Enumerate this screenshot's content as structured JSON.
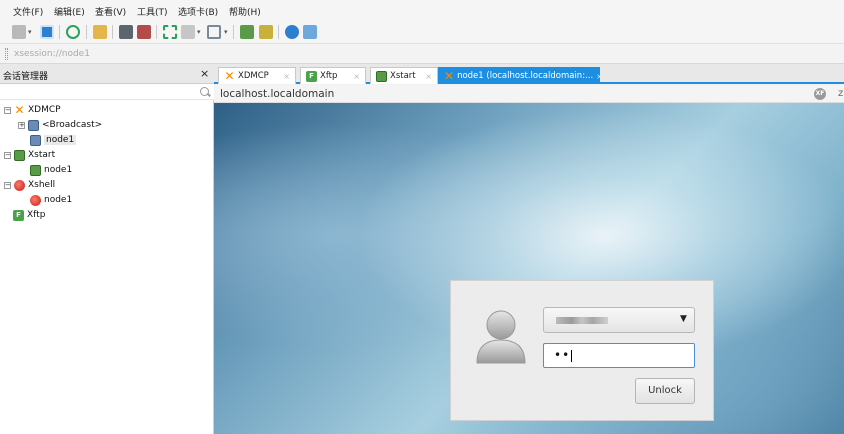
{
  "menubar": {
    "items": [
      "文件(F)",
      "编辑(E)",
      "查看(V)",
      "工具(T)",
      "选项卡(B)",
      "帮助(H)"
    ]
  },
  "toolbar": {
    "icons": [
      "new-session-icon",
      "session-properties-icon",
      "reconnect-icon",
      "find-icon",
      "screenshot-icon",
      "record-icon",
      "fullscreen-icon",
      "layout-icon",
      "tab-icon",
      "xstart-icon",
      "xftp-icon",
      "help-icon",
      "chat-icon"
    ]
  },
  "address": {
    "value": "xsession://node1"
  },
  "session_manager": {
    "title": "会话管理器",
    "close": "×",
    "tree": [
      {
        "label": "XDMCP",
        "icon": "xdmcp-icon",
        "expander": "−"
      },
      {
        "label": "<Broadcast>",
        "icon": "monitor-icon",
        "expander": "+"
      },
      {
        "label": "node1",
        "icon": "monitor-icon"
      },
      {
        "label": "Xstart",
        "icon": "xstart-icon",
        "expander": "−"
      },
      {
        "label": "node1",
        "icon": "xstart-icon"
      },
      {
        "label": "Xshell",
        "icon": "xshell-icon",
        "expander": "−"
      },
      {
        "label": "node1",
        "icon": "xshell-icon"
      },
      {
        "label": "Xftp",
        "icon": "xftp-icon"
      }
    ]
  },
  "tabs": [
    {
      "label": "XDMCP",
      "icon": "xdmcp-icon",
      "close": "×"
    },
    {
      "label": "Xftp",
      "icon": "xftp-icon",
      "close": "×"
    },
    {
      "label": "Xstart",
      "icon": "xstart-icon",
      "close": "×"
    },
    {
      "label": "node1 (localhost.localdomain:...",
      "icon": "xdmcp-icon",
      "close": "×",
      "active": true
    }
  ],
  "remote": {
    "title": "localhost.localdomain",
    "logo_text": "XF",
    "trailing": "z"
  },
  "lock_dialog": {
    "password_mask": "••",
    "unlock_label": "Unlock"
  },
  "colors": {
    "accent": "#1e8fe0",
    "xdmcp_orange": "#f08a00"
  }
}
